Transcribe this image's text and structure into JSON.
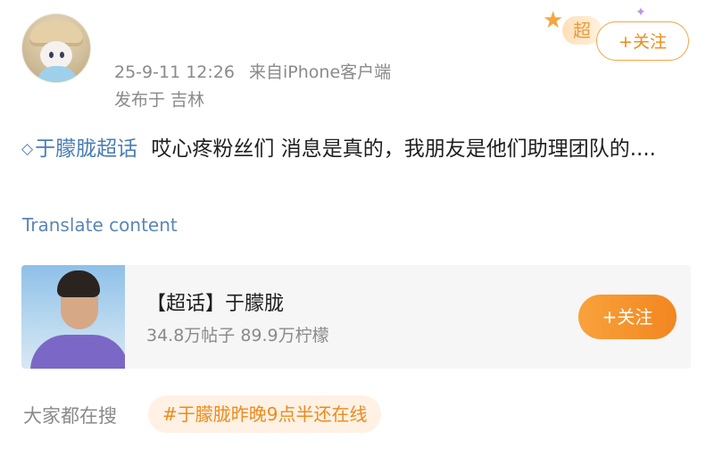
{
  "post": {
    "timestamp": "25-9-11 12:26",
    "source": "来自iPhone客户端",
    "location": "发布于 吉林",
    "topic_tag": "于朦胧超话",
    "text": "哎心疼粉丝们 消息是真的，我朋友是他们助理团队的....",
    "translate_label": "Translate content"
  },
  "badge": {
    "label": "超"
  },
  "follow_button": {
    "label": "+关注"
  },
  "topic_card": {
    "title": "【超话】于朦胧",
    "stats": "34.8万帖子 89.9万柠檬",
    "follow_label": "+关注"
  },
  "search": {
    "label": "大家都在搜",
    "chip": "#于朦胧昨晚9点半还在线"
  },
  "colors": {
    "accent_orange": "#ef8a1a",
    "link_blue": "#4a7db8",
    "muted_gray": "#8a8a8a"
  },
  "icons": [
    "user-avatar",
    "star-icon",
    "sparkle-icon",
    "diamond-topic-icon"
  ]
}
